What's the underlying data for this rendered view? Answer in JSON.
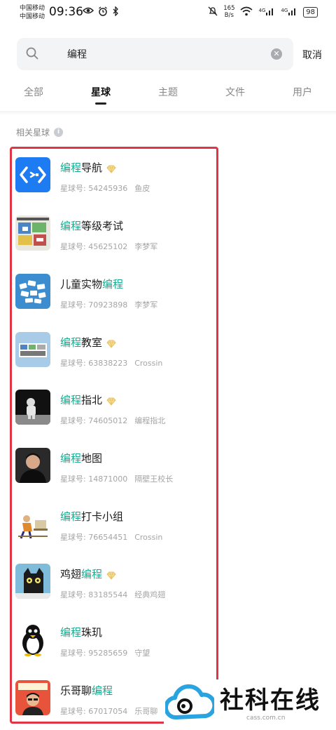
{
  "status_bar": {
    "carrier_1": "中国移动",
    "carrier_2": "中国移动",
    "time": "09:36",
    "speed_value": "165",
    "speed_unit": "B/s",
    "signal_1": "4G",
    "signal_2": "4G",
    "battery": "98"
  },
  "search": {
    "query": "编程",
    "cancel_label": "取消"
  },
  "tabs": [
    {
      "label": "全部",
      "active": false
    },
    {
      "label": "星球",
      "active": true
    },
    {
      "label": "主题",
      "active": false
    },
    {
      "label": "文件",
      "active": false
    },
    {
      "label": "用户",
      "active": false
    }
  ],
  "section": {
    "title": "相关星球",
    "info_glyph": "i"
  },
  "planets": [
    {
      "name_pre": "",
      "name_hl": "编程",
      "name_post": "导航",
      "premium": true,
      "id_label": "星球号: 54245936",
      "owner": "鱼皮"
    },
    {
      "name_pre": "",
      "name_hl": "编程",
      "name_post": "等级考试",
      "premium": false,
      "id_label": "星球号: 45625102",
      "owner": "李梦军"
    },
    {
      "name_pre": "儿童实物",
      "name_hl": "编程",
      "name_post": "",
      "premium": false,
      "id_label": "星球号: 70923898",
      "owner": "李梦军"
    },
    {
      "name_pre": "",
      "name_hl": "编程",
      "name_post": "教室",
      "premium": true,
      "id_label": "星球号: 63838223",
      "owner": "Crossin"
    },
    {
      "name_pre": "",
      "name_hl": "编程",
      "name_post": "指北",
      "premium": true,
      "id_label": "星球号: 74605012",
      "owner": "编程指北"
    },
    {
      "name_pre": "",
      "name_hl": "编程",
      "name_post": "地图",
      "premium": false,
      "id_label": "星球号: 14871000",
      "owner": "隔壁王校长"
    },
    {
      "name_pre": "",
      "name_hl": "编程",
      "name_post": "打卡小组",
      "premium": false,
      "id_label": "星球号: 76654451",
      "owner": "Crossin"
    },
    {
      "name_pre": "鸡翅",
      "name_hl": "编程",
      "name_post": "",
      "premium": true,
      "id_label": "星球号: 83185544",
      "owner": "经典鸡翅"
    },
    {
      "name_pre": "",
      "name_hl": "编程",
      "name_post": "珠玑",
      "premium": false,
      "id_label": "星球号: 95285659",
      "owner": "守望"
    },
    {
      "name_pre": "乐哥聊",
      "name_hl": "编程",
      "name_post": "",
      "premium": false,
      "id_label": "星球号: 67017054",
      "owner": "乐哥聊"
    }
  ],
  "colors": {
    "highlight": "#1aaa8f",
    "annotation_border": "#e03545",
    "premium_diamond": "#e8c15a"
  },
  "watermark": {
    "brand": "社科在线",
    "url": "cass.com.cn"
  }
}
